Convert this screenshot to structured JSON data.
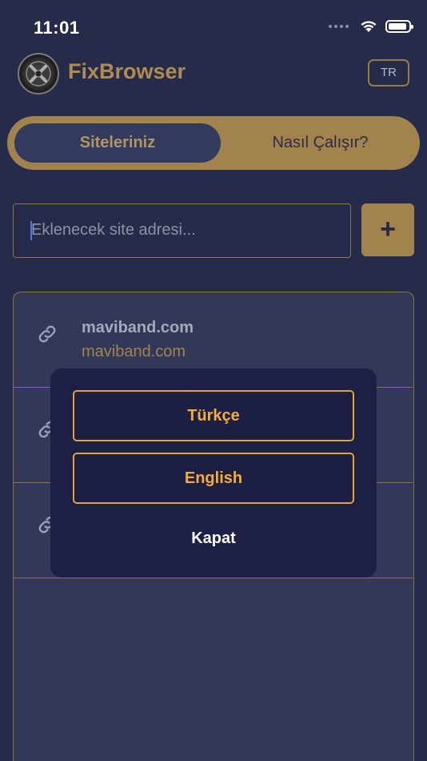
{
  "status_bar": {
    "time": "11:01"
  },
  "header": {
    "app_title": "FixBrowser",
    "language_button": "TR"
  },
  "tabs": [
    {
      "label": "Siteleriniz",
      "active": true
    },
    {
      "label": "Nasıl Çalışır?",
      "active": false
    }
  ],
  "add_site": {
    "placeholder": "Eklenecek site adresi...",
    "value": "",
    "add_button": "+"
  },
  "sites": [
    {
      "name": "maviband.com",
      "url": "maviband.com"
    },
    {
      "name": "",
      "url": ""
    },
    {
      "name": "",
      "url": ""
    }
  ],
  "language_modal": {
    "options": [
      "Türkçe",
      "English"
    ],
    "close_label": "Kapat"
  },
  "colors": {
    "background": "#272b4a",
    "accent": "#a2834e",
    "modal_bg": "#1d1f44",
    "modal_accent": "#e0a53a"
  }
}
